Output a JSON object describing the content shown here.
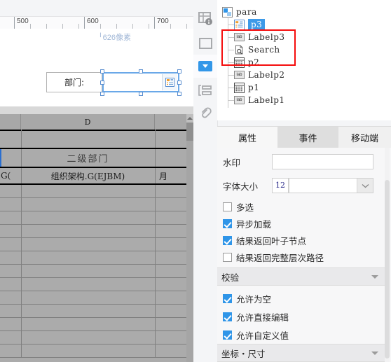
{
  "canvas": {
    "ruler": {
      "labels": [
        "500",
        "600",
        "700"
      ],
      "unit_hint": "626像素"
    },
    "widget": {
      "label_text": "部门:",
      "input_value": "",
      "picker_icon": "tree-picker-icon",
      "selected": true
    }
  },
  "spreadsheet": {
    "column_headers": [
      "",
      "D",
      ""
    ],
    "merged_title": "二级部门",
    "formula_cells": [
      "G(",
      "组织架构.G(EJBM)",
      "月"
    ],
    "empty_rows": 12
  },
  "rail": {
    "items": [
      {
        "name": "data-source-icon",
        "label": "数据集",
        "active": false
      },
      {
        "name": "frame-icon",
        "label": "区块",
        "active": false
      },
      {
        "name": "dropdown-widget-icon",
        "label": "控件",
        "active": true
      },
      {
        "name": "layout-icon",
        "label": "布局",
        "active": false
      },
      {
        "name": "link-icon",
        "label": "超链接",
        "active": false
      }
    ]
  },
  "tree": {
    "root": {
      "label": "para",
      "icon": "folder-node-icon"
    },
    "nodes": [
      {
        "label": "p3",
        "icon": "tree-widget-icon",
        "selected": true
      },
      {
        "label": "Labelp3",
        "icon": "label-icon",
        "selected": false
      },
      {
        "label": "Search",
        "icon": "search-doc-icon",
        "selected": false
      },
      {
        "label": "p2",
        "icon": "grid-widget-icon",
        "selected": false
      },
      {
        "label": "Labelp2",
        "icon": "label-icon",
        "selected": false
      },
      {
        "label": "p1",
        "icon": "grid-widget-icon",
        "selected": false
      },
      {
        "label": "Labelp1",
        "icon": "label-icon",
        "selected": false
      }
    ]
  },
  "tabs": [
    {
      "label": "属性",
      "active": true
    },
    {
      "label": "事件",
      "active": false
    },
    {
      "label": "移动端",
      "active": false
    }
  ],
  "properties": {
    "watermark": {
      "label": "水印",
      "value": "",
      "placeholder": ""
    },
    "font_size": {
      "label": "字体大小",
      "value": "12",
      "dropdown_value": ""
    },
    "multi_select": {
      "label": "多选",
      "checked": false
    },
    "async_load": {
      "label": "异步加载",
      "checked": true
    },
    "return_leaf": {
      "label": "结果返回叶子节点",
      "checked": true
    },
    "return_full_path": {
      "label": "结果返回完整层次路径",
      "checked": false
    },
    "section_validate": {
      "label": "校验"
    },
    "allow_empty": {
      "label": "允许为空",
      "checked": true
    },
    "allow_direct_edit": {
      "label": "允许直接编辑",
      "checked": true
    },
    "allow_custom_value": {
      "label": "允许自定义值",
      "checked": true
    },
    "section_coord_size": {
      "label": "坐标・尺寸"
    }
  },
  "annotation": {
    "highlight_color": "#f50d0d",
    "highlight_target": "字体大小 / 多选"
  },
  "colors": {
    "accent_blue": "#3397e8",
    "checkbox_blue": "#2f95e8",
    "selection_blue": "#3d9ae8",
    "red_marker": "#f50d0d"
  }
}
